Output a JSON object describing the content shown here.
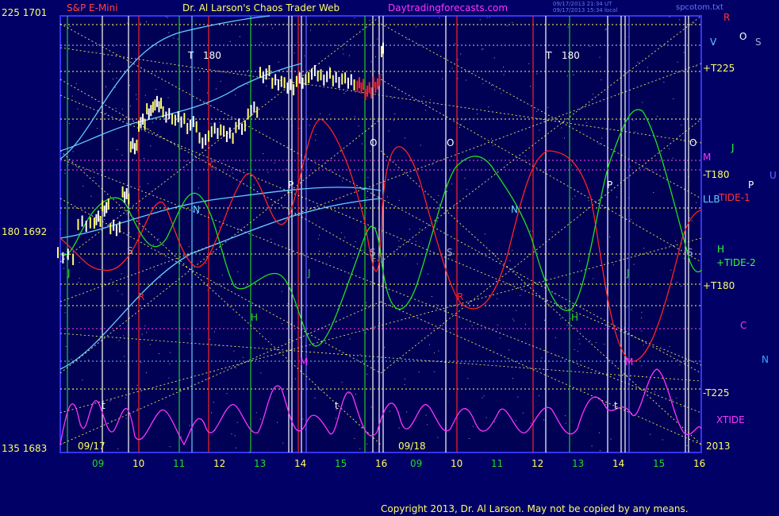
{
  "header": {
    "symbol": "S&P E-Mini",
    "title": "Dr. Al Larson's Chaos Trader Web",
    "site": "Daytradingforecasts.com",
    "timestamp1": "09/17/2013 21:34 UT",
    "timestamp2": "09/17/2013 15:34 local",
    "file": "spcotom.txt"
  },
  "y_labels": {
    "top": "225  1701",
    "mid": "180  1692",
    "bottom": "135  1683"
  },
  "copyright": "Copyright 2013, Dr. Al Larson. May not be copied by any means.",
  "colors": {
    "background": "#000066",
    "price": "#ffffff",
    "grid_yellow": "#ffff66",
    "tide1": "#ff2222",
    "tide2": "#22dd22",
    "xtide": "#ff33ff",
    "cyan": "#66ccff"
  },
  "chart_data": {
    "type": "line",
    "ylim": [
      1683,
      1701
    ],
    "y_ticks": [
      {
        "angle": "225",
        "price": 1701
      },
      {
        "angle": "180",
        "price": 1692
      },
      {
        "angle": "135",
        "price": 1683
      }
    ],
    "x_day1_hours": [
      "09",
      "10",
      "11",
      "12",
      "13",
      "14",
      "15",
      "16"
    ],
    "x_day2_hours": [
      "09",
      "10",
      "11",
      "12",
      "13",
      "14",
      "15",
      "16"
    ],
    "date_labels": [
      "09/17",
      "09/18",
      "2013"
    ],
    "right_labels": [
      {
        "text": "+T225",
        "color": "#ffff66"
      },
      {
        "text": "M",
        "color": "#ff33ff"
      },
      {
        "text": "-T180",
        "color": "#ffff66"
      },
      {
        "text": "LLB",
        "color": "#66ccff"
      },
      {
        "text": "TIDE-1",
        "color": "#ff3333"
      },
      {
        "text": "+TIDE-2",
        "color": "#33ff33"
      },
      {
        "text": "H",
        "color": "#33ff33"
      },
      {
        "text": "+T180",
        "color": "#ffff66"
      },
      {
        "text": "-T225",
        "color": "#ffff66"
      },
      {
        "text": "XTIDE",
        "color": "#ff33ff"
      },
      {
        "text": "J",
        "color": "#33ff33"
      },
      {
        "text": "R",
        "color": "#ff3333"
      },
      {
        "text": "O",
        "color": "#ffffff"
      },
      {
        "text": "S",
        "color": "#aaaacc"
      },
      {
        "text": "V",
        "color": "#66ccff"
      },
      {
        "text": "U",
        "color": "#6666ff"
      },
      {
        "text": "P",
        "color": "#ffffff"
      },
      {
        "text": "C",
        "color": "#ff33ff"
      },
      {
        "text": "N",
        "color": "#33aaff"
      }
    ],
    "markers": [
      "T",
      "180",
      "O",
      "P",
      "S",
      "N",
      "J",
      "H",
      "M",
      "R",
      "C",
      "t"
    ],
    "price_series": {
      "name": "S&P E-Mini",
      "x_hours": [
        8.0,
        8.5,
        8.9,
        9.1,
        9.3,
        9.6,
        9.8,
        10.0,
        10.2,
        10.4,
        10.6,
        10.9,
        11.2,
        11.5,
        11.8,
        12.1,
        12.4,
        12.7,
        13.0,
        13.3,
        13.6,
        13.9,
        14.2,
        14.5,
        14.8,
        15.1,
        15.4,
        15.6,
        15.8,
        16.0
      ],
      "values": [
        1691.0,
        1692.3,
        1692.5,
        1693.0,
        1692.2,
        1693.5,
        1695.5,
        1696.5,
        1697.0,
        1697.3,
        1696.8,
        1696.6,
        1696.4,
        1695.8,
        1696.2,
        1696.0,
        1696.3,
        1697.0,
        1698.5,
        1698.2,
        1698.0,
        1698.2,
        1698.5,
        1698.4,
        1698.3,
        1698.2,
        1698.0,
        1697.8,
        1698.1,
        1699.5
      ]
    }
  }
}
